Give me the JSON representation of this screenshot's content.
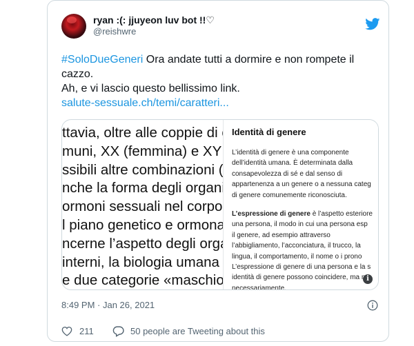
{
  "author": {
    "display_name": "ryan :(: jjuyeon luv bot !!♡",
    "handle": "@reishwre"
  },
  "tweet": {
    "hashtag": "#SoloDueGeneri",
    "line1_rest": " Ora andate tutti a dormire e non rompete il",
    "line2": "cazzo.",
    "line3": "Ah, e vi lascio questo bellissimo link.",
    "link": "salute-sessuale.ch/temi/caratteri..."
  },
  "media": {
    "big_lines": [
      "ttavia, oltre alle coppie di c",
      "muni, XX (femmina) e XY (",
      "ssibili altre combinazioni (",
      "nche la forma degli organi g",
      "ormoni sessuali nel corpo",
      "l piano genetico e ormonal",
      "ncerne l’aspetto degli orga",
      " interni, la biologia umana",
      "e due categorie «maschio»"
    ],
    "panel_title": "Identità di genere",
    "panel_para1": [
      "L’identità di genere è una componente",
      "dell’identità umana. È determinata dalla",
      "consapevolezza di sé e dal senso di",
      "appartenenza a un genere o a nessuna categ",
      "di genere comunemente riconosciuta."
    ],
    "panel_para2_bold": "L’espressione di genere",
    "panel_para2_first_rest": " è l’aspetto esteriore",
    "panel_para2": [
      "una persona, il modo in cui una persona esp",
      "il genere, ad esempio attraverso",
      "l’abbigliamento, l’acconciatura, il trucco, la",
      "lingua, il comportamento, il nome o i prono",
      "L’espressione di genere di una persona e la s",
      "identità di genere possono coincidere, ma no",
      "necessariamente."
    ],
    "info_glyph": "i"
  },
  "meta": {
    "time": "8:49 PM",
    "separator": " · ",
    "date": "Jan 26, 2021"
  },
  "actions": {
    "likes": "211",
    "people_tweeting": "50 people are Tweeting about this"
  },
  "colors": {
    "link": "#1b95e0",
    "secondary_text": "#536471",
    "border": "#cfd9de",
    "twitter_blue": "#1d9bf0"
  }
}
